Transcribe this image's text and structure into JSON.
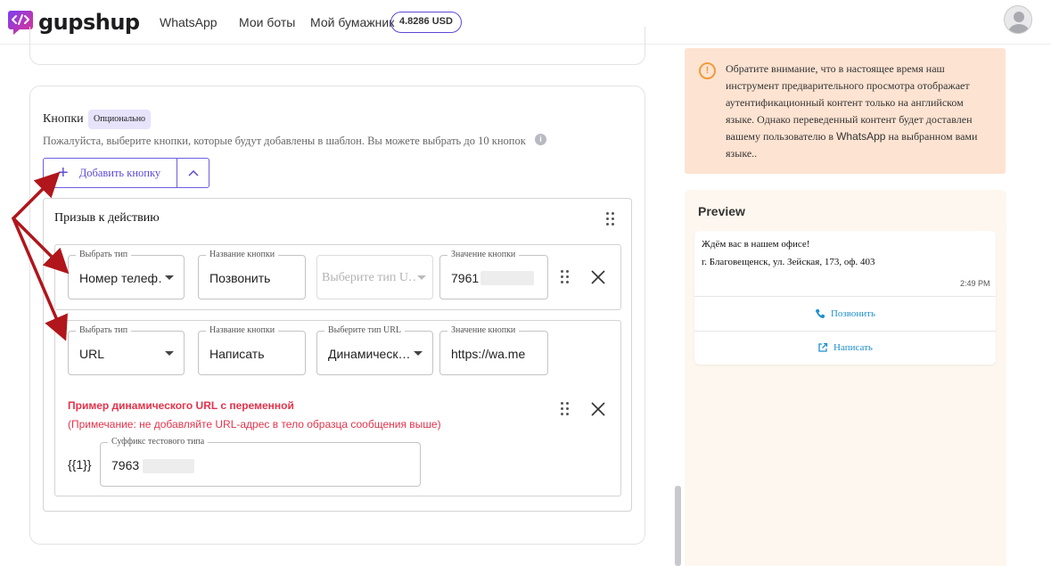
{
  "header": {
    "brand": "gupshup",
    "nav": [
      "WhatsApp",
      "Мои боты",
      "Мой бумажник"
    ],
    "balance": "4.8286 USD"
  },
  "buttons_section": {
    "title": "Кнопки",
    "badge": "Опционально",
    "hint": "Пожалуйста, выберите кнопки, которые будут добавлены в шаблон. Вы можете выбрать до 10 кнопок",
    "add_button_label": "Добавить кнопку",
    "group_title": "Призыв к действию",
    "row1": {
      "type_label": "Выбрать тип",
      "type_value": "Номер телеф…",
      "name_label": "Название кнопки",
      "name_value": "Позвонить",
      "url_type_placeholder": "Выберите тип U…",
      "value_label": "Значение кнопки",
      "value_value": "7961"
    },
    "row2": {
      "type_label": "Выбрать тип",
      "type_value": "URL",
      "name_label": "Название кнопки",
      "name_value": "Написать",
      "url_type_label": "Выберите тип URL",
      "url_type_value": "Динамическ…",
      "value_label": "Значение кнопки",
      "value_value": "https://wa.me",
      "dynamic_title": "Пример динамического URL с переменной",
      "dynamic_note": "(Примечание: не добавляйте URL-адрес в тело образца сообщения выше)",
      "variable": "{{1}}",
      "suffix_label": "Суффикс тестового типа",
      "suffix_value": "7963"
    }
  },
  "notice": {
    "text_before": "Обратите внимание, что в настоящее время наш инструмент предварительного просмотра отображает аутентификационный контент только на английском языке. Однако переведенный контент будет доставлен вашему пользователю в ",
    "brand": "WhatsApp",
    "text_after": " на выбранном вами языке.."
  },
  "preview": {
    "title": "Preview",
    "line1": "Ждём вас в нашем офисе!",
    "line2": "г. Благовещенск, ул. Зейская, 173, оф. 403",
    "time": "2:49 PM",
    "button1": "Позвонить",
    "button2": "Написать"
  },
  "colors": {
    "accent": "#5b49d6",
    "error": "#e5334b",
    "notice_bg": "#fde3d2",
    "preview_bg": "#fdf7ef",
    "link": "#1f8fd1",
    "annotation_arrow": "#b0161b"
  }
}
